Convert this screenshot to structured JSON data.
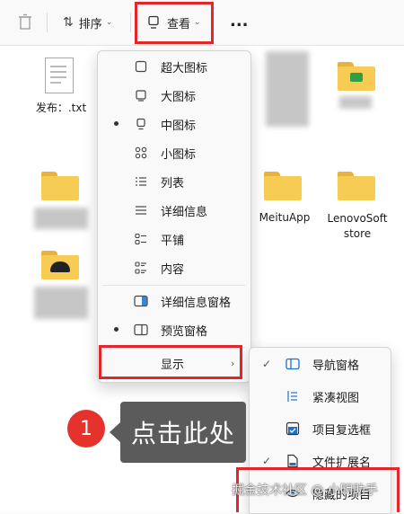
{
  "toolbar": {
    "sort_label": "排序",
    "view_label": "查看",
    "more_label": "..."
  },
  "files": {
    "txt_name": "发布：.txt",
    "meitu_name": "MeituApp",
    "lenovo_name": "LenovoSoftstore"
  },
  "view_menu": {
    "items": [
      {
        "label": "超大图标",
        "icon": "monitor-icon"
      },
      {
        "label": "大图标",
        "icon": "monitor-icon"
      },
      {
        "label": "中图标",
        "icon": "monitor-icon",
        "selected": true
      },
      {
        "label": "小图标",
        "icon": "small-icons-icon"
      },
      {
        "label": "列表",
        "icon": "list-icon"
      },
      {
        "label": "详细信息",
        "icon": "details-icon"
      },
      {
        "label": "平铺",
        "icon": "tiles-icon"
      },
      {
        "label": "内容",
        "icon": "content-icon"
      },
      {
        "label": "详细信息窗格",
        "icon": "details-pane-icon"
      },
      {
        "label": "预览窗格",
        "icon": "preview-pane-icon",
        "selected": true
      },
      {
        "label": "显示",
        "icon": "chevron-right-icon"
      }
    ]
  },
  "show_submenu": {
    "items": [
      {
        "label": "导航窗格",
        "checked": true,
        "icon": "navigation-pane-icon"
      },
      {
        "label": "紧凑视图",
        "checked": false,
        "icon": "compact-view-icon"
      },
      {
        "label": "项目复选框",
        "checked": false,
        "icon": "checkbox-icon"
      },
      {
        "label": "文件扩展名",
        "checked": true,
        "icon": "file-extension-icon"
      },
      {
        "label": "隐藏的项目",
        "checked": false,
        "icon": "hidden-items-icon"
      }
    ]
  },
  "annotation": {
    "badge_number": "1",
    "callout_text": "点击此处"
  },
  "watermark": "掘金技术社区 @ 小明助手",
  "colors": {
    "highlight": "#e3262b",
    "badge": "#e5322d",
    "callout_bg": "#5b5b5b",
    "folder": "#f7cc55"
  }
}
